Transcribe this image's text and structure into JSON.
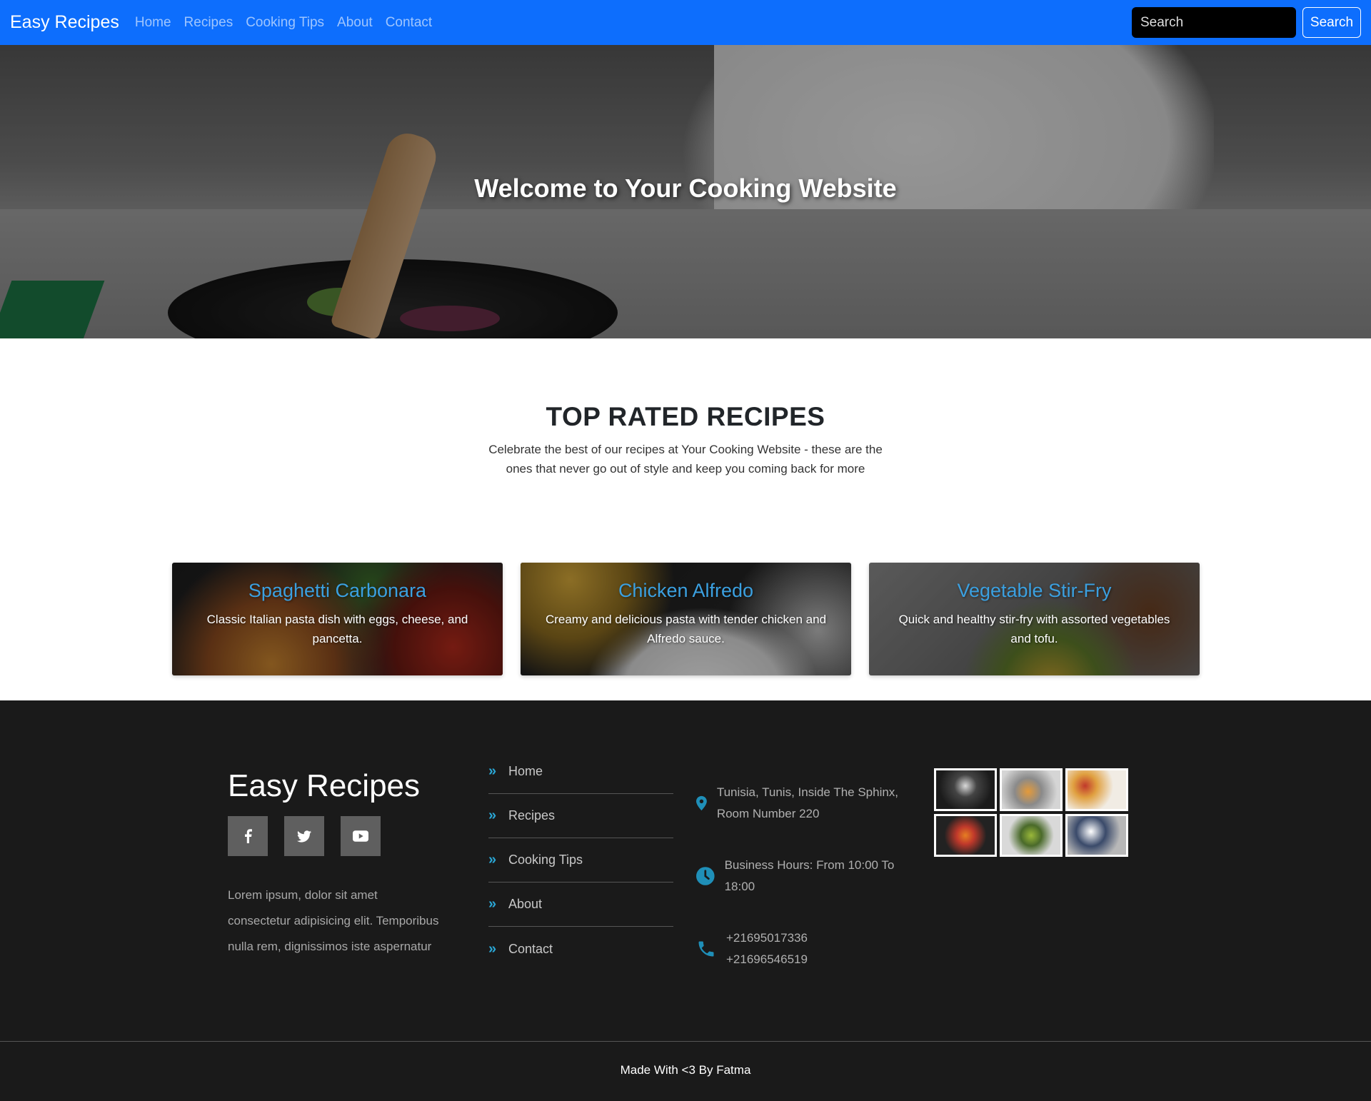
{
  "nav": {
    "brand": "Easy Recipes",
    "links": [
      "Home",
      "Recipes",
      "Cooking Tips",
      "About",
      "Contact"
    ],
    "search_placeholder": "Search",
    "search_button": "Search"
  },
  "hero": {
    "title": "Welcome to Your Cooking Website"
  },
  "top_rated": {
    "title": "TOP RATED RECIPES",
    "description": "Celebrate the best of our recipes at Your Cooking Website - these are the ones that never go out of style and keep you coming back for more",
    "cards": [
      {
        "title": "Spaghetti Carbonara",
        "text": "Classic Italian pasta dish with eggs, cheese, and pancetta."
      },
      {
        "title": "Chicken Alfredo",
        "text": "Creamy and delicious pasta with tender chicken and Alfredo sauce."
      },
      {
        "title": "Vegetable Stir-Fry",
        "text": "Quick and healthy stir-fry with assorted vegetables and tofu."
      }
    ]
  },
  "footer": {
    "brand": "Easy Recipes",
    "socials": [
      "facebook-icon",
      "twitter-icon",
      "youtube-icon"
    ],
    "about": "Lorem ipsum, dolor sit amet consectetur adipisicing elit. Temporibus nulla rem, dignissimos iste aspernatur",
    "links": [
      "Home",
      "Recipes",
      "Cooking Tips",
      "About",
      "Contact"
    ],
    "address": "Tunisia, Tunis, Inside The Sphinx, Room Number 220",
    "hours": "Business Hours: From 10:00 To 18:00",
    "phones": [
      "+21695017336",
      "+21696546519"
    ],
    "credit": "Made With <3 By Fatma"
  },
  "colors": {
    "navbar": "#0d6efd",
    "accent": "#2aa7d6",
    "card_title": "#3ba0e0",
    "footer_bg": "#1a1a1a"
  }
}
